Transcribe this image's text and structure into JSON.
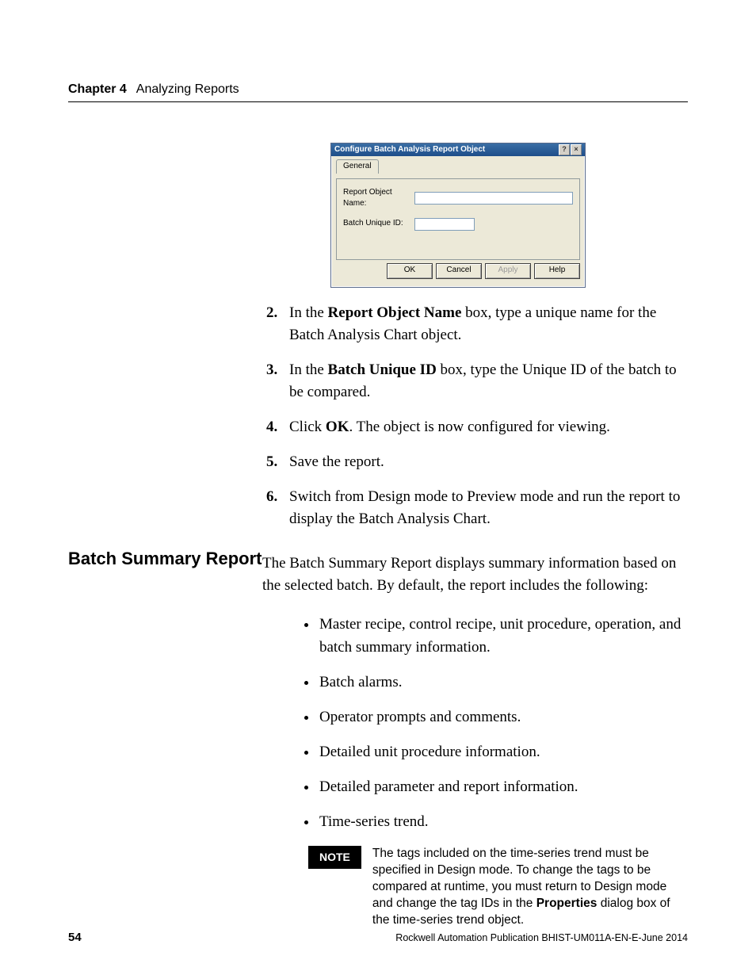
{
  "header": {
    "chapter_num": "Chapter 4",
    "chapter_title": "Analyzing Reports"
  },
  "dialog": {
    "title": "Configure Batch Analysis Report Object",
    "tab": "General",
    "row1_label": "Report Object Name:",
    "row2_label": "Batch Unique ID:",
    "row1_value": "",
    "row2_value": "",
    "btn_ok": "OK",
    "btn_cancel": "Cancel",
    "btn_apply": "Apply",
    "btn_help": "Help",
    "title_help_glyph": "?",
    "title_close_glyph": "×"
  },
  "steps": {
    "s2a": "In the ",
    "s2b": "Report Object Name",
    "s2c": " box, type a unique name for the Batch Analysis Chart object.",
    "s3a": "In the ",
    "s3b": "Batch Unique ID",
    "s3c": " box, type the Unique ID of the batch to be compared.",
    "s4a": "Click ",
    "s4b": "OK",
    "s4c": ". The object is now configured for viewing.",
    "s5": "Save the report.",
    "s6": "Switch from Design mode to Preview mode and run the report to display the Batch Analysis Chart."
  },
  "section_heading": "Batch Summary Report",
  "intro": "The Batch Summary Report displays summary information based on the selected batch. By default, the report includes the following:",
  "bullets": {
    "b1": "Master recipe, control recipe, unit procedure, operation, and batch summary information.",
    "b2": "Batch alarms.",
    "b3": "Operator prompts and comments.",
    "b4": "Detailed unit procedure information.",
    "b5": "Detailed parameter and report information.",
    "b6": "Time-series trend."
  },
  "note": {
    "badge": "NOTE",
    "text_a": "The tags included on the time-series trend must be specified in Design mode. To change the tags to be compared at runtime, you must return to Design mode and change the tag IDs in the ",
    "text_b": "Properties",
    "text_c": " dialog box of the time-series trend object."
  },
  "footer": {
    "page": "54",
    "pub": "Rockwell Automation Publication BHIST-UM011A-EN-E-June 2014"
  }
}
